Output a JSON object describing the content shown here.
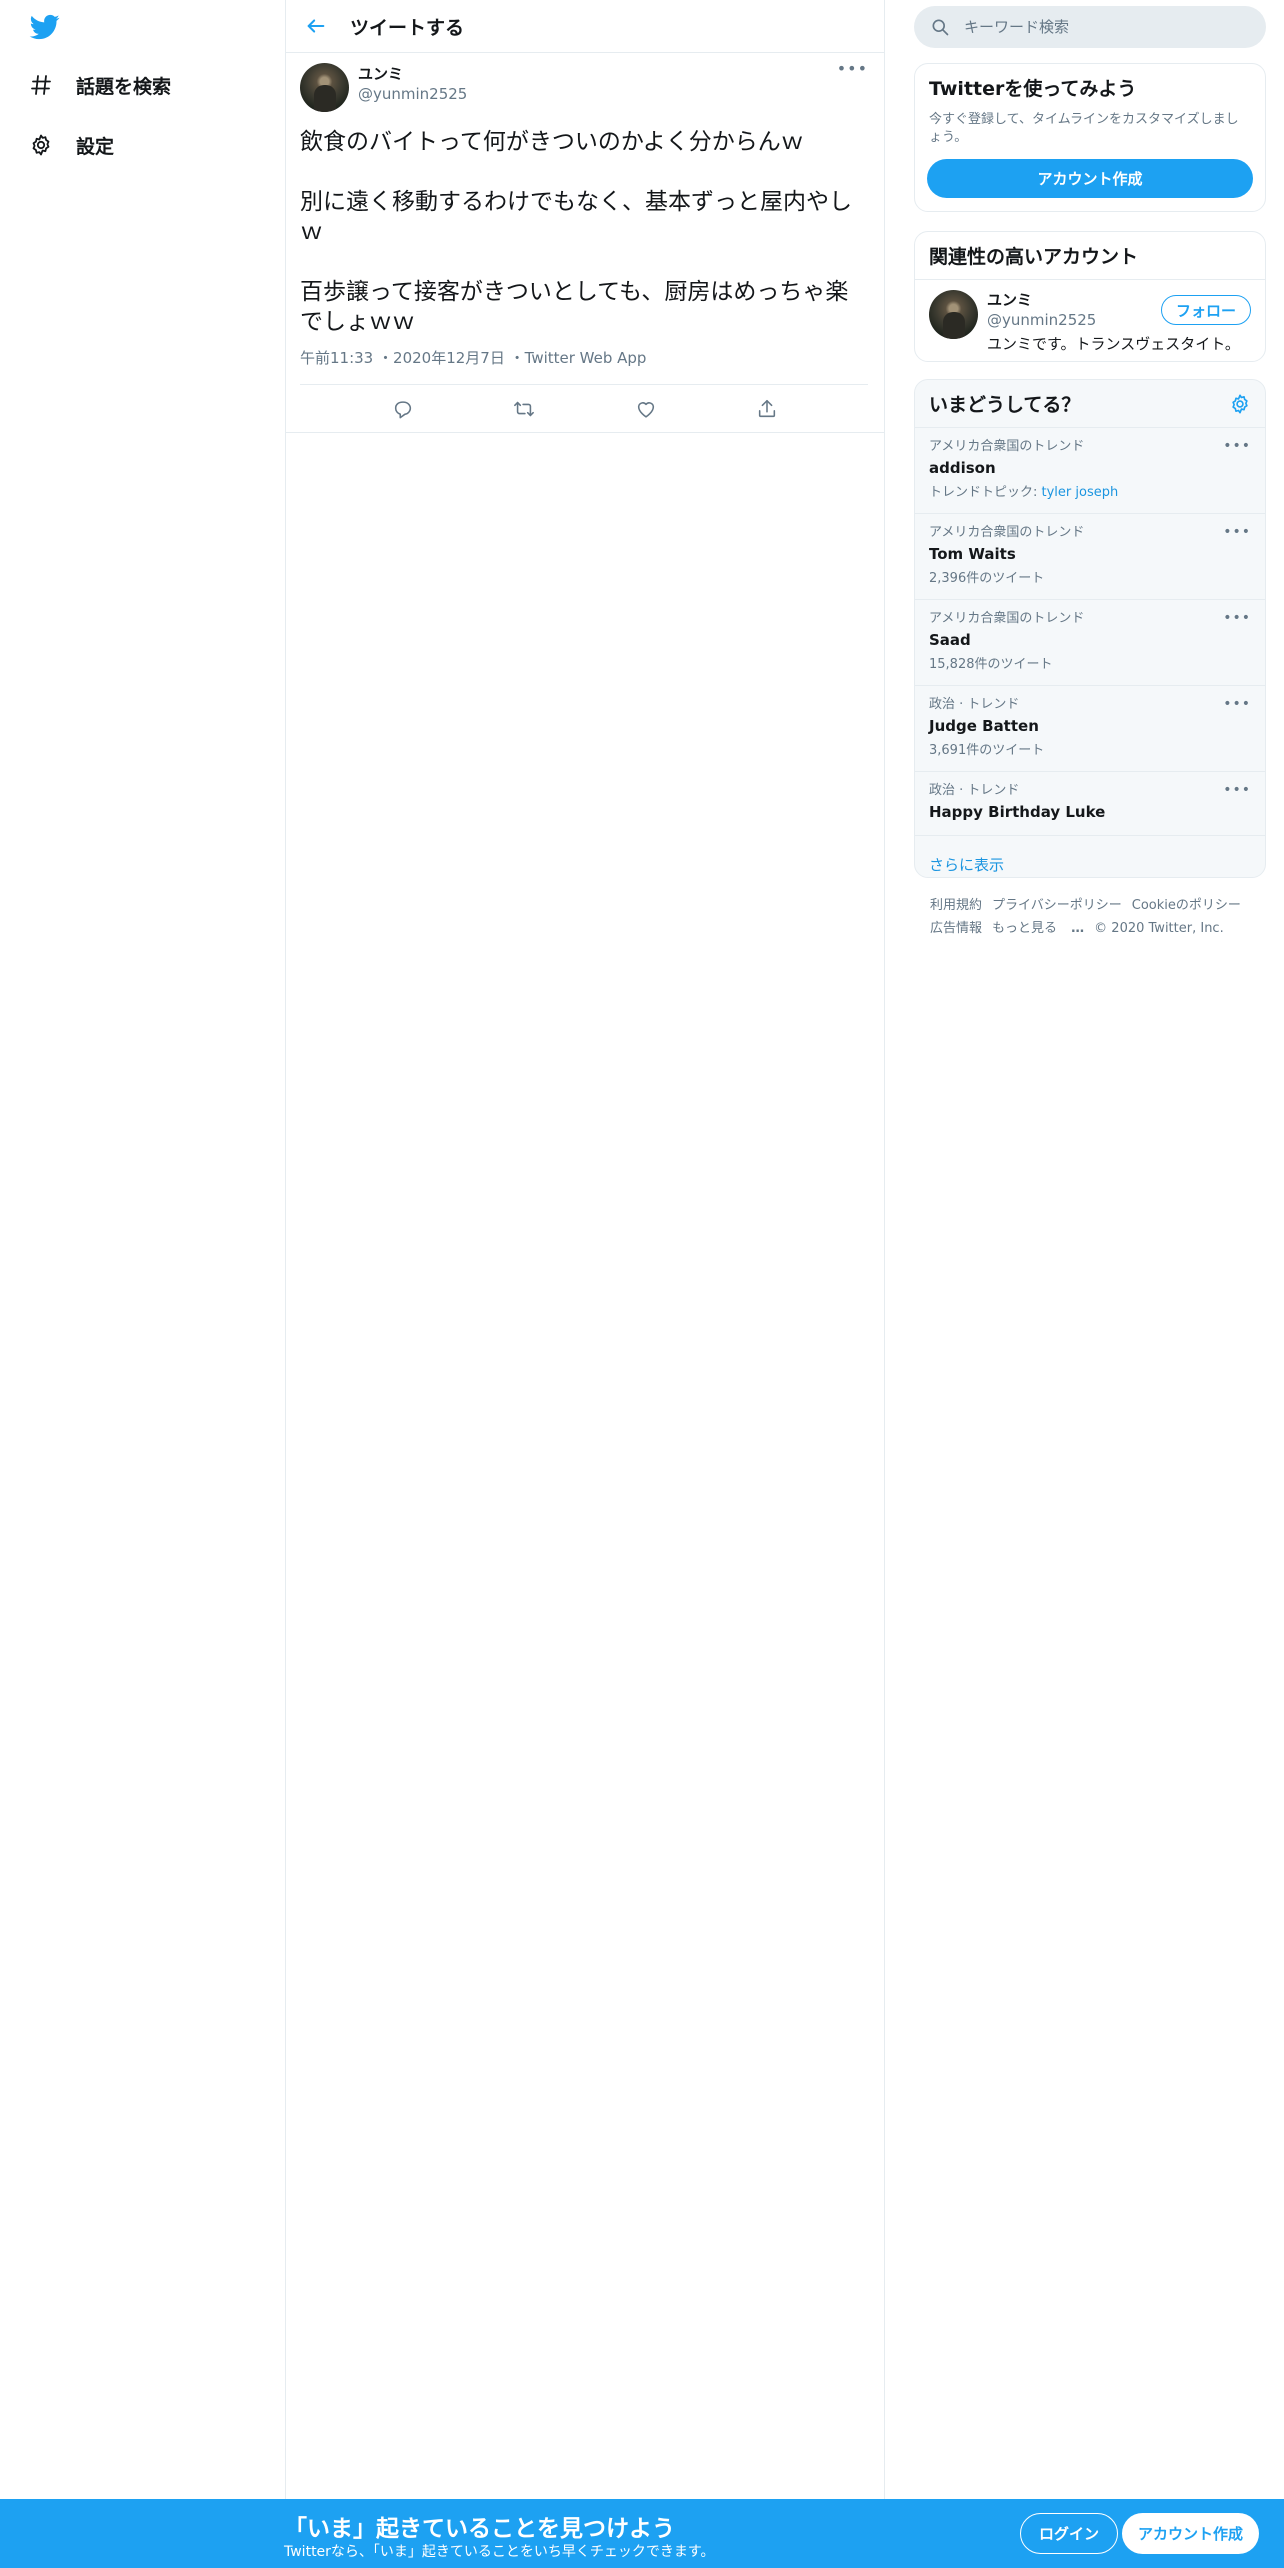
{
  "nav": {
    "logo": "twitter-bird-icon",
    "items": [
      {
        "label": "話題を検索",
        "icon": "hashtag-icon"
      },
      {
        "label": "設定",
        "icon": "gear-icon"
      }
    ]
  },
  "main": {
    "header_title": "ツイートする",
    "tweet": {
      "author_name": "ユンミ",
      "author_handle": "@yunmin2525",
      "text_lines": [
        "飲食のバイトって何がきついのかよく分からんｗ",
        "別に遠く移動するわけでもなく、基本ずっと屋内やしｗ",
        "百歩譲って接客がきついとしても、厨房はめっちゃ楽でしょｗｗ"
      ],
      "time": "午前11:33",
      "date": "2020年12月7日",
      "source": "Twitter Web App"
    }
  },
  "right": {
    "search_placeholder": "キーワード検索",
    "signup": {
      "title": "Twitterを使ってみよう",
      "subtitle": "今すぐ登録して、タイムラインをカスタマイズしましょう。",
      "button": "アカウント作成"
    },
    "related": {
      "title": "関連性の高いアカウント",
      "name": "ユンミ",
      "handle": "@yunmin2525",
      "bio": "ユンミです。トランスヴェスタイト。",
      "follow": "フォロー"
    },
    "trends": {
      "title": "いまどうしてる？",
      "items": [
        {
          "category": "アメリカ合衆国のトレンド",
          "name": "addison",
          "topic_prefix": "トレンドトピック: ",
          "topic": "tyler joseph"
        },
        {
          "category": "アメリカ合衆国のトレンド",
          "name": "Tom Waits",
          "count": "2,396件のツイート"
        },
        {
          "category": "アメリカ合衆国のトレンド",
          "name": "Saad",
          "count": "15,828件のツイート"
        },
        {
          "category": "政治 · トレンド",
          "name": "Judge Batten",
          "count": "3,691件のツイート"
        },
        {
          "category": "政治 · トレンド",
          "name": "Happy Birthday Luke"
        }
      ],
      "show_more": "さらに表示"
    },
    "footer": {
      "terms": "利用規約",
      "privacy": "プライバシーポリシー",
      "cookie": "Cookieのポリシー",
      "ads": "広告情報",
      "more": "もっと見る",
      "copyright": "© 2020 Twitter, Inc."
    }
  },
  "bottom_bar": {
    "title": "「いま」起きていることを見つけよう",
    "subtitle": "Twitterなら、「いま」起きていることをいち早くチェックできます。",
    "login": "ログイン",
    "signup": "アカウント作成"
  },
  "colors": {
    "accent": "#1da1f2",
    "link": "#1b95e0",
    "secondary_text": "#657786",
    "border": "#e6ecf0"
  }
}
